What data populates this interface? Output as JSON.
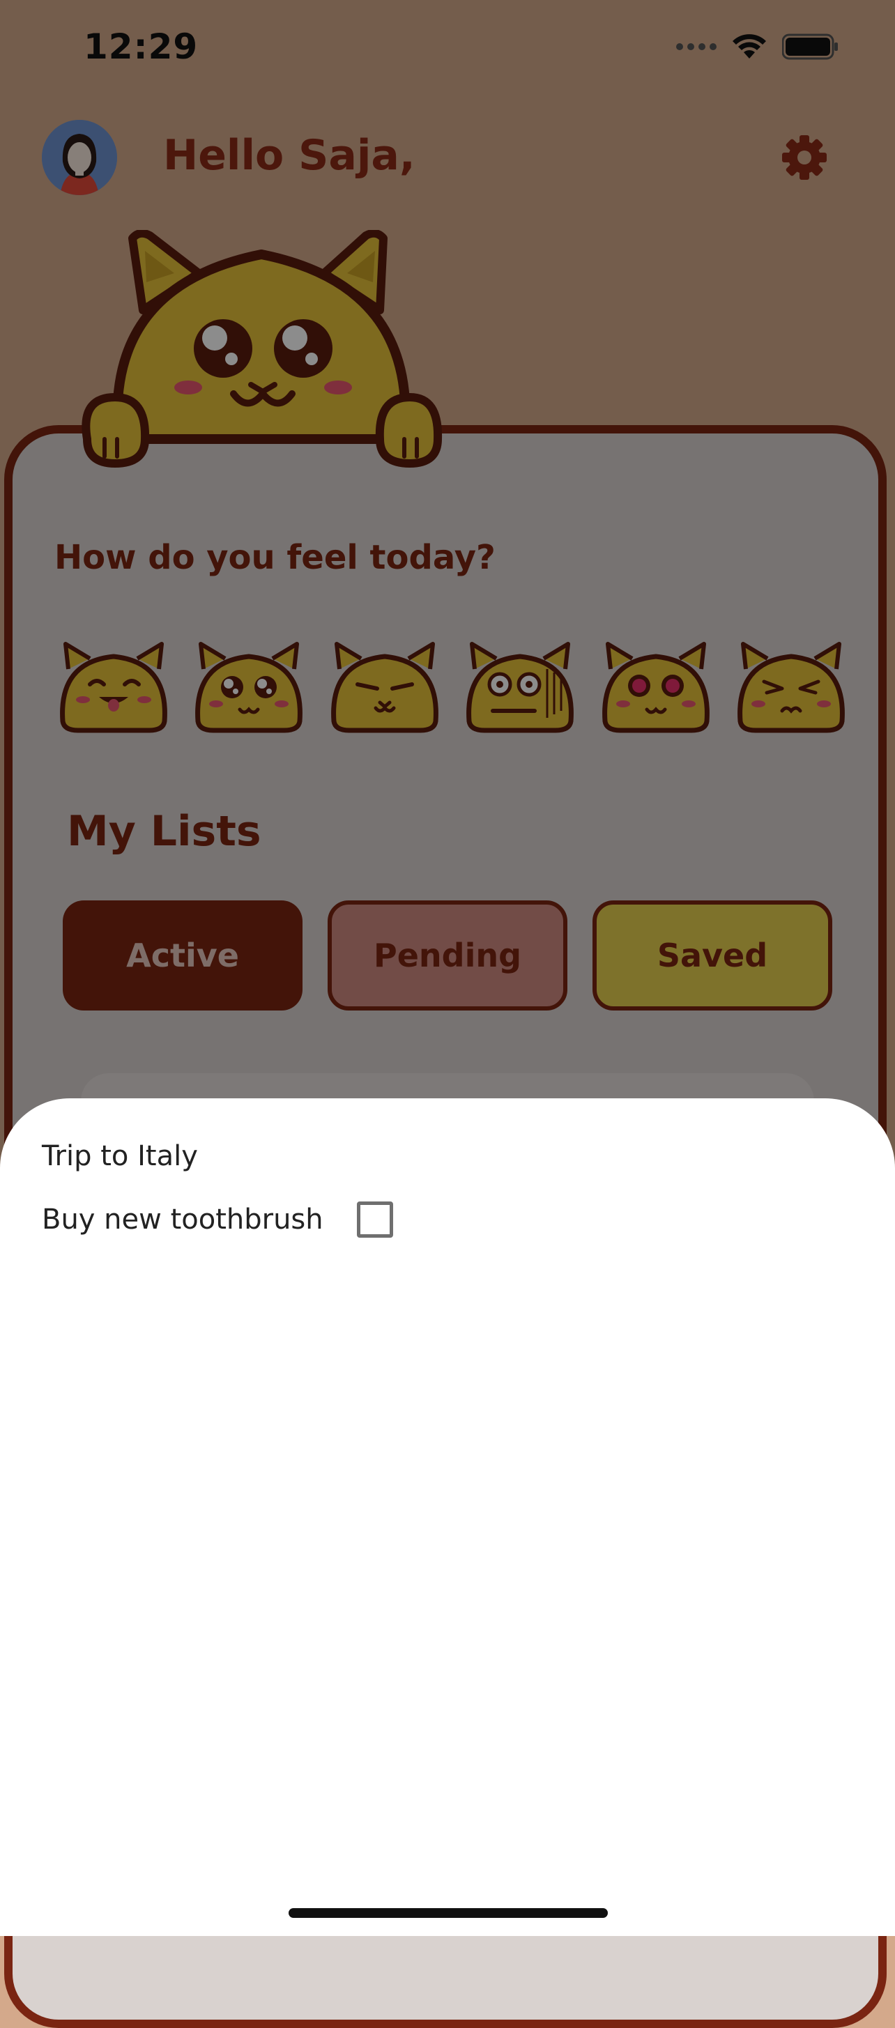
{
  "status_bar": {
    "time": "12:29"
  },
  "header": {
    "greeting": "Hello Saja,"
  },
  "mood_section": {
    "title": "How do you feel today?",
    "moods": [
      "happy-cat-icon",
      "dizzy-cat-icon",
      "annoyed-cat-icon",
      "stressed-cat-icon",
      "angry-cat-icon",
      "sad-cat-icon"
    ]
  },
  "lists": {
    "title": "My Lists",
    "tabs": [
      {
        "label": "Active"
      },
      {
        "label": "Pending"
      },
      {
        "label": "Saved"
      }
    ]
  },
  "sheet": {
    "title": "Trip to Italy",
    "items": [
      {
        "label": "Buy new toothbrush",
        "checked": false
      }
    ]
  },
  "colors": {
    "brand_brown": "#7a2512",
    "mascot_yellow": "#e6c23a",
    "pending_pink": "#cf8a82",
    "saved_yellow": "#e6cf4f"
  }
}
